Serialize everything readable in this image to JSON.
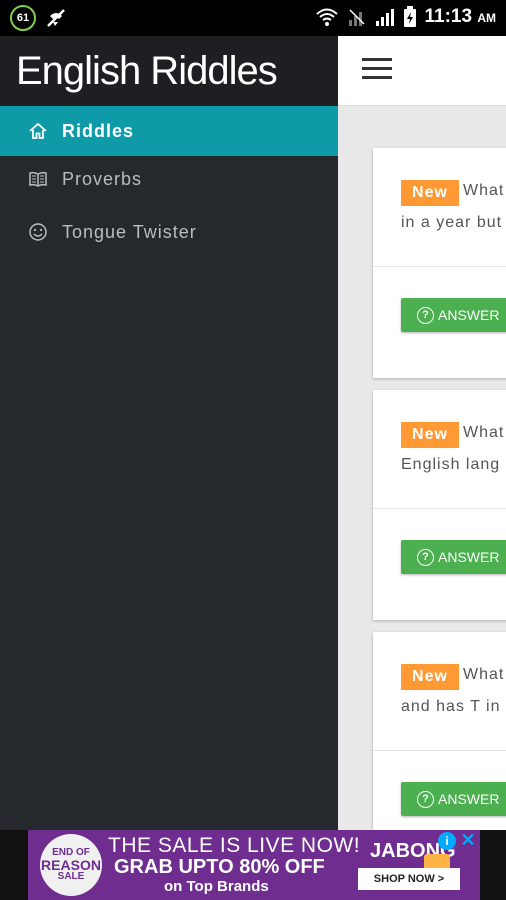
{
  "status_bar": {
    "notification_badge": "61",
    "time": "11:13",
    "ampm": "AM"
  },
  "drawer": {
    "title": "English Riddles",
    "items": [
      {
        "label": "Riddles",
        "icon": "home-icon",
        "active": true
      },
      {
        "label": "Proverbs",
        "icon": "book-icon",
        "active": false
      },
      {
        "label": "Tongue Twister",
        "icon": "smile-icon",
        "active": false
      }
    ]
  },
  "cards": [
    {
      "badge": "New",
      "line1": "What",
      "line2": "in a year but",
      "answer_label": "ANSWER"
    },
    {
      "badge": "New",
      "line1": "What",
      "line2": "English lang",
      "answer_label": "ANSWER"
    },
    {
      "badge": "New",
      "line1": "What",
      "line2": "and has T in",
      "answer_label": "ANSWER"
    }
  ],
  "ad": {
    "logo_top": "END OF",
    "logo_mid": "REASON",
    "logo_bottom": "SALE",
    "line1": "THE SALE IS LIVE NOW!",
    "line2": "GRAB UPTO 80% OFF",
    "line3": "on Top Brands",
    "brand": "JABONG",
    "cta": "SHOP NOW >",
    "info": "i",
    "close": "✕"
  },
  "colors": {
    "drawer_bg": "#25282d",
    "active_item": "#0e9aa7",
    "badge_orange": "#ff9933",
    "answer_green": "#4caf50",
    "ad_purple": "#6e2d8f"
  }
}
